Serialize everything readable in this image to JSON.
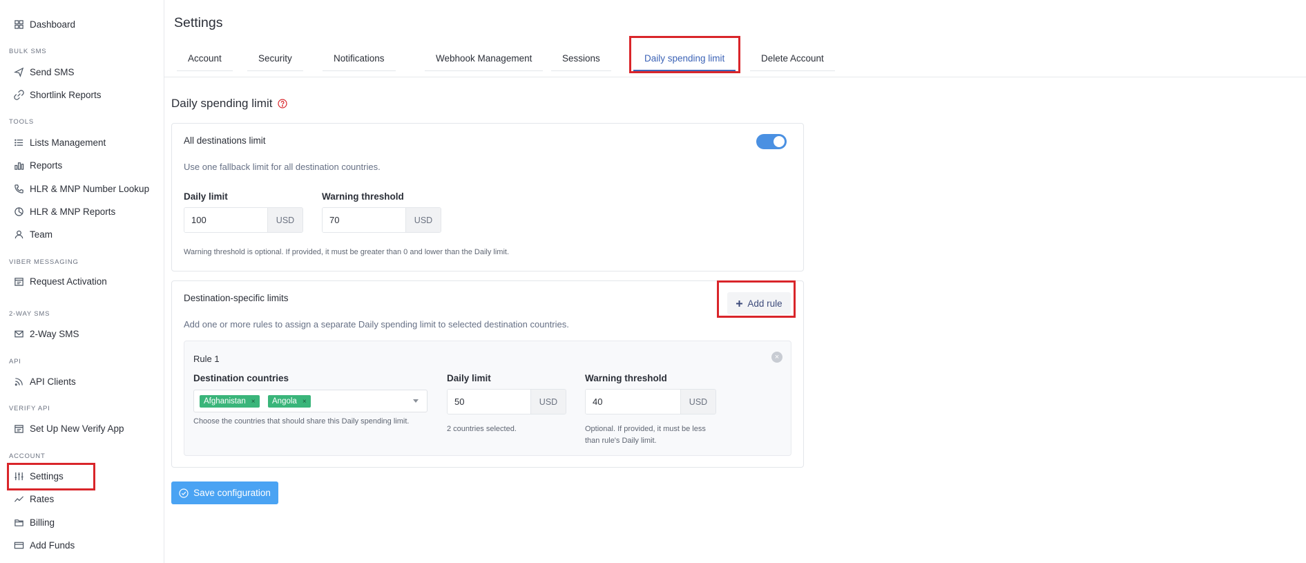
{
  "sidebar": {
    "items": [
      {
        "label": "Dashboard",
        "icon": "grid-icon"
      },
      {
        "label": "Send SMS",
        "icon": "send-icon"
      },
      {
        "label": "Shortlink Reports",
        "icon": "link-icon"
      },
      {
        "label": "Lists Management",
        "icon": "list-icon"
      },
      {
        "label": "Reports",
        "icon": "bar-chart-icon"
      },
      {
        "label": "HLR & MNP Number Lookup",
        "icon": "phone-icon"
      },
      {
        "label": "HLR & MNP Reports",
        "icon": "pie-icon"
      },
      {
        "label": "Team",
        "icon": "user-icon"
      },
      {
        "label": "Request Activation",
        "icon": "calendar-icon"
      },
      {
        "label": "2-Way SMS",
        "icon": "mail-icon"
      },
      {
        "label": "API Clients",
        "icon": "rss-icon"
      },
      {
        "label": "Set Up New Verify App",
        "icon": "calendar-icon"
      },
      {
        "label": "Settings",
        "icon": "sliders-icon"
      },
      {
        "label": "Rates",
        "icon": "trend-icon"
      },
      {
        "label": "Billing",
        "icon": "folder-icon"
      },
      {
        "label": "Add Funds",
        "icon": "credit-card-icon"
      }
    ],
    "sections": [
      "BULK SMS",
      "TOOLS",
      "VIBER MESSAGING",
      "2-WAY SMS",
      "API",
      "VERIFY API",
      "ACCOUNT"
    ]
  },
  "header": {
    "title": "Settings"
  },
  "tabs": [
    {
      "label": "Account"
    },
    {
      "label": "Security"
    },
    {
      "label": "Notifications"
    },
    {
      "label": "Webhook Management"
    },
    {
      "label": "Sessions"
    },
    {
      "label": "Daily spending limit"
    },
    {
      "label": "Delete Account"
    }
  ],
  "active_tab": "Daily spending limit",
  "page": {
    "title": "Daily spending limit",
    "all_dest": {
      "title": "All destinations limit",
      "toggle_on": true,
      "desc": "Use one fallback limit for all destination countries.",
      "daily_label": "Daily limit",
      "daily_value": "100",
      "warning_label": "Warning threshold",
      "warning_value": "70",
      "currency": "USD",
      "hint": "Warning threshold is optional. If provided, it must be greater than 0 and lower than the Daily limit."
    },
    "dest_specific": {
      "title": "Destination-specific limits",
      "add_rule": "Add rule",
      "desc": "Add one or more rules to assign a separate Daily spending limit to selected destination countries.",
      "rule": {
        "title": "Rule 1",
        "countries_label": "Destination countries",
        "countries": [
          "Afghanistan",
          "Angola"
        ],
        "countries_hint": "Choose the countries that should share this Daily spending limit.",
        "daily_label": "Daily limit",
        "daily_value": "50",
        "daily_hint": "2 countries selected.",
        "warning_label": "Warning threshold",
        "warning_value": "40",
        "warning_hint_1": "Optional. If provided, it must be less",
        "warning_hint_2": "than rule's Daily limit.",
        "currency": "USD"
      }
    },
    "save": "Save configuration"
  },
  "colors": {
    "accent": "#3c63b6",
    "save": "#4aa3f3",
    "chip": "#3ab57a",
    "highlight": "#d9252a",
    "toggle": "#4a90e2"
  }
}
